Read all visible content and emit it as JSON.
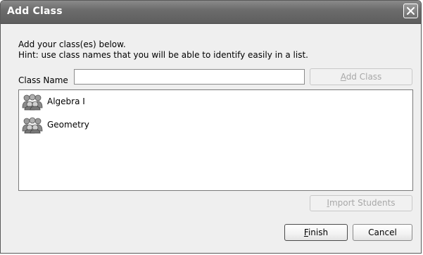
{
  "window": {
    "title": "Add Class",
    "close_icon": "close-x-icon"
  },
  "instructions": {
    "line1": "Add your class(es) below.",
    "line2": "Hint: use class names that you will be able to identify easily in a list."
  },
  "class_name": {
    "label": "Class Name",
    "value": "",
    "placeholder": ""
  },
  "buttons": {
    "add_class": {
      "access_key": "A",
      "rest": "dd Class",
      "enabled": false
    },
    "import_students": {
      "access_key": "I",
      "rest": "mport Students",
      "enabled": false
    },
    "finish": {
      "access_key": "F",
      "rest": "inish",
      "enabled": true
    },
    "cancel": {
      "label": "Cancel",
      "enabled": true
    }
  },
  "class_list": {
    "items": [
      {
        "label": "Algebra I",
        "icon": "class-group-icon"
      },
      {
        "label": "Geometry",
        "icon": "class-group-icon"
      }
    ]
  }
}
